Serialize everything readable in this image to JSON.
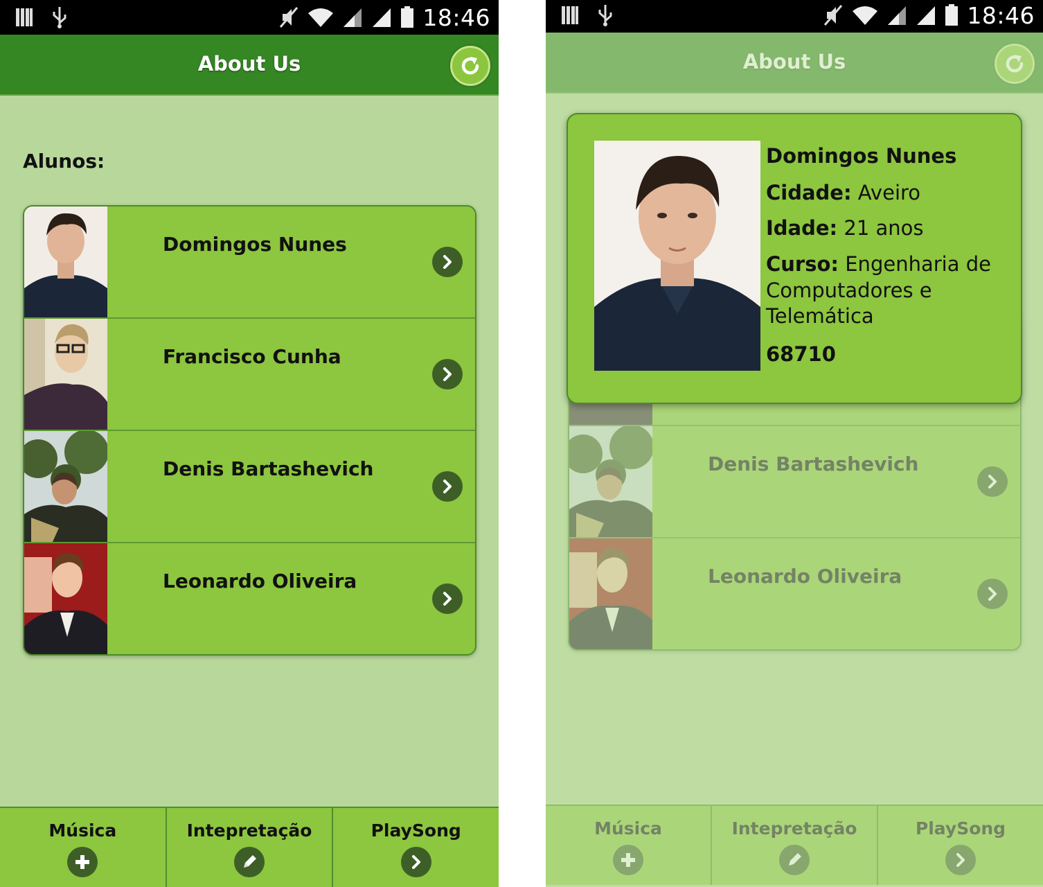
{
  "status_bar": {
    "time": "18:46"
  },
  "header": {
    "title": "About Us"
  },
  "section_label": "Alunos:",
  "students": [
    {
      "name": "Domingos Nunes"
    },
    {
      "name": "Francisco Cunha"
    },
    {
      "name": "Denis Bartashevich"
    },
    {
      "name": "Leonardo Oliveira"
    }
  ],
  "nav": [
    {
      "label": "Música",
      "icon": "plus-icon"
    },
    {
      "label": "Intepretação",
      "icon": "pencil-icon"
    },
    {
      "label": "PlaySong",
      "icon": "chevron-right-icon"
    }
  ],
  "popup": {
    "name": "Domingos Nunes",
    "city_label": "Cidade:",
    "city_value": "Aveiro",
    "age_label": "Idade:",
    "age_value": "21 anos",
    "course_label": "Curso:",
    "course_value": "Engenharia de Computadores e Telemática",
    "number": "68710"
  },
  "colors": {
    "header_bg": "#358724",
    "item_bg": "#8dc63f",
    "page_bg": "#b8d79b",
    "icon_circle": "#3d5f27"
  }
}
